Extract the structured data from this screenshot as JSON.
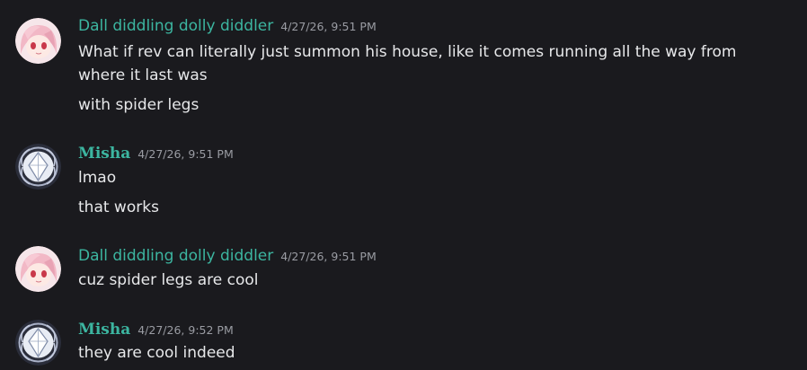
{
  "messages": [
    {
      "username": "Dall diddling dolly diddler",
      "timestamp": "4/27/26, 9:51 PM",
      "lines": [
        "What if rev can literally just summon his house, like it comes running all the way from where it last was",
        "with spider legs"
      ]
    },
    {
      "username": "Misha",
      "timestamp": "4/27/26, 9:51 PM",
      "lines": [
        "lmao",
        "that works"
      ]
    },
    {
      "username": "Dall diddling dolly diddler",
      "timestamp": "4/27/26, 9:51 PM",
      "lines": [
        "cuz spider legs are cool"
      ]
    },
    {
      "username": "Misha",
      "timestamp": "4/27/26, 9:52 PM",
      "lines": [
        "they are cool indeed"
      ]
    }
  ],
  "colors": {
    "background": "#1a1a1e",
    "username": "#3cb5a0",
    "timestamp": "#9a9ca3",
    "text": "#e7e8ea"
  },
  "icons": {
    "avatar_dall": "anime-girl-avatar",
    "avatar_misha": "crystal-emblem-avatar"
  }
}
